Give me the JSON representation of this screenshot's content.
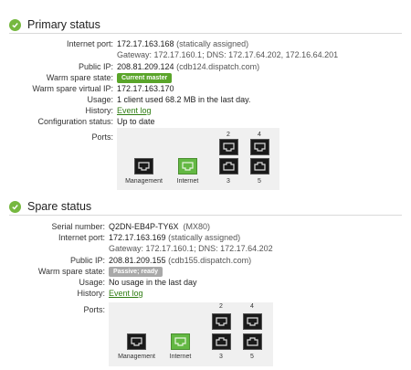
{
  "primary": {
    "title": "Primary status",
    "labels": {
      "internet_port": "Internet port:",
      "public_ip": "Public IP:",
      "warm_spare_state": "Warm spare state:",
      "warm_spare_vip": "Warm spare virtual IP:",
      "usage": "Usage:",
      "history": "History:",
      "config_status": "Configuration status:",
      "ports": "Ports:"
    },
    "internet_port_ip": "172.17.163.168",
    "internet_port_note": "(statically assigned)",
    "gateway_line": "Gateway: 172.17.160.1; DNS: 172.17.64.202, 172.16.64.201",
    "public_ip": "208.81.209.124",
    "public_host": "(cdb124.dispatch.com)",
    "warm_spare_state": "Current master",
    "warm_spare_vip": "172.17.163.170",
    "usage": "1 client used 68.2 MB in the last day.",
    "history_link": "Event log",
    "config_status": "Up to date",
    "ports": {
      "management": "Management",
      "internet": "Internet",
      "p2": "2",
      "p3": "3",
      "p4": "4",
      "p5": "5"
    }
  },
  "spare": {
    "title": "Spare status",
    "labels": {
      "serial": "Serial number:",
      "internet_port": "Internet port:",
      "public_ip": "Public IP:",
      "warm_spare_state": "Warm spare state:",
      "usage": "Usage:",
      "history": "History:",
      "ports": "Ports:"
    },
    "serial": "Q2DN-EB4P-TY6X",
    "model": "(MX80)",
    "internet_port_ip": "172.17.163.169",
    "internet_port_note": "(statically assigned)",
    "gateway_line": "Gateway: 172.17.160.1; DNS: 172.17.64.202",
    "public_ip": "208.81.209.155",
    "public_host": "(cdb155.dispatch.com)",
    "warm_spare_state": "Passive; ready",
    "usage": "No usage in the last day",
    "history_link": "Event log",
    "ports": {
      "management": "Management",
      "internet": "Internet",
      "p2": "2",
      "p3": "3",
      "p4": "4",
      "p5": "5"
    }
  },
  "colors": {
    "accent_green": "#76b83f",
    "badge_green": "#5aa52a",
    "badge_gray": "#a9a9a9",
    "link_green": "#2f7d12"
  },
  "icons": {
    "section": "check-circle-icon",
    "port": "ethernet-port-icon"
  }
}
